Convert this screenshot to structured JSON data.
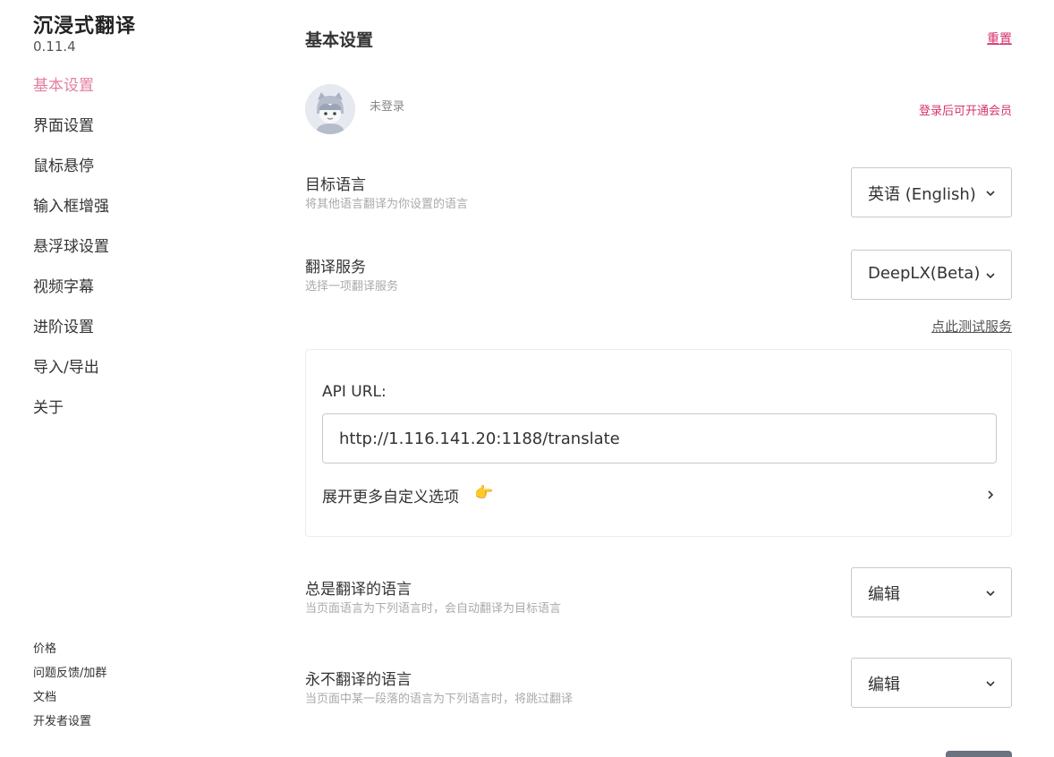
{
  "sidebar": {
    "app_title": "沉浸式翻译",
    "version": "0.11.4",
    "nav": [
      {
        "label": "基本设置"
      },
      {
        "label": "界面设置"
      },
      {
        "label": "鼠标悬停"
      },
      {
        "label": "输入框增强"
      },
      {
        "label": "悬浮球设置"
      },
      {
        "label": "视频字幕"
      },
      {
        "label": "进阶设置"
      },
      {
        "label": "导入/导出"
      },
      {
        "label": "关于"
      }
    ],
    "footer_links": [
      {
        "label": "价格"
      },
      {
        "label": "问题反馈/加群"
      },
      {
        "label": "文档"
      },
      {
        "label": "开发者设置"
      }
    ]
  },
  "header": {
    "title": "基本设置",
    "reset_label": "重置"
  },
  "account": {
    "status": "未登录",
    "member_link": "登录后可开通会员"
  },
  "settings": {
    "target_language": {
      "label": "目标语言",
      "desc": "将其他语言翻译为你设置的语言",
      "value": "英语 (English)"
    },
    "translation_service": {
      "label": "翻译服务",
      "desc": "选择一项翻译服务",
      "value": "DeepLX(Beta)"
    },
    "test_service_link": "点此测试服务",
    "always_translate": {
      "label": "总是翻译的语言",
      "desc": "当页面语言为下列语言时，会自动翻译为目标语言",
      "value": "编辑"
    },
    "never_translate": {
      "label": "永不翻译的语言",
      "desc": "当页面中某一段落的语言为下列语言时，将跳过翻译",
      "value": "编辑"
    }
  },
  "api_card": {
    "label": "API URL:",
    "url_value": "http://1.116.141.20:1188/translate",
    "expand_label": "展开更多自定义选项",
    "expand_icon": "pointing-hand-icon"
  },
  "colors": {
    "accent": "#e4809f",
    "link_red": "#d6336c",
    "muted": "#aaaaaa",
    "border": "#c9c9c9"
  }
}
